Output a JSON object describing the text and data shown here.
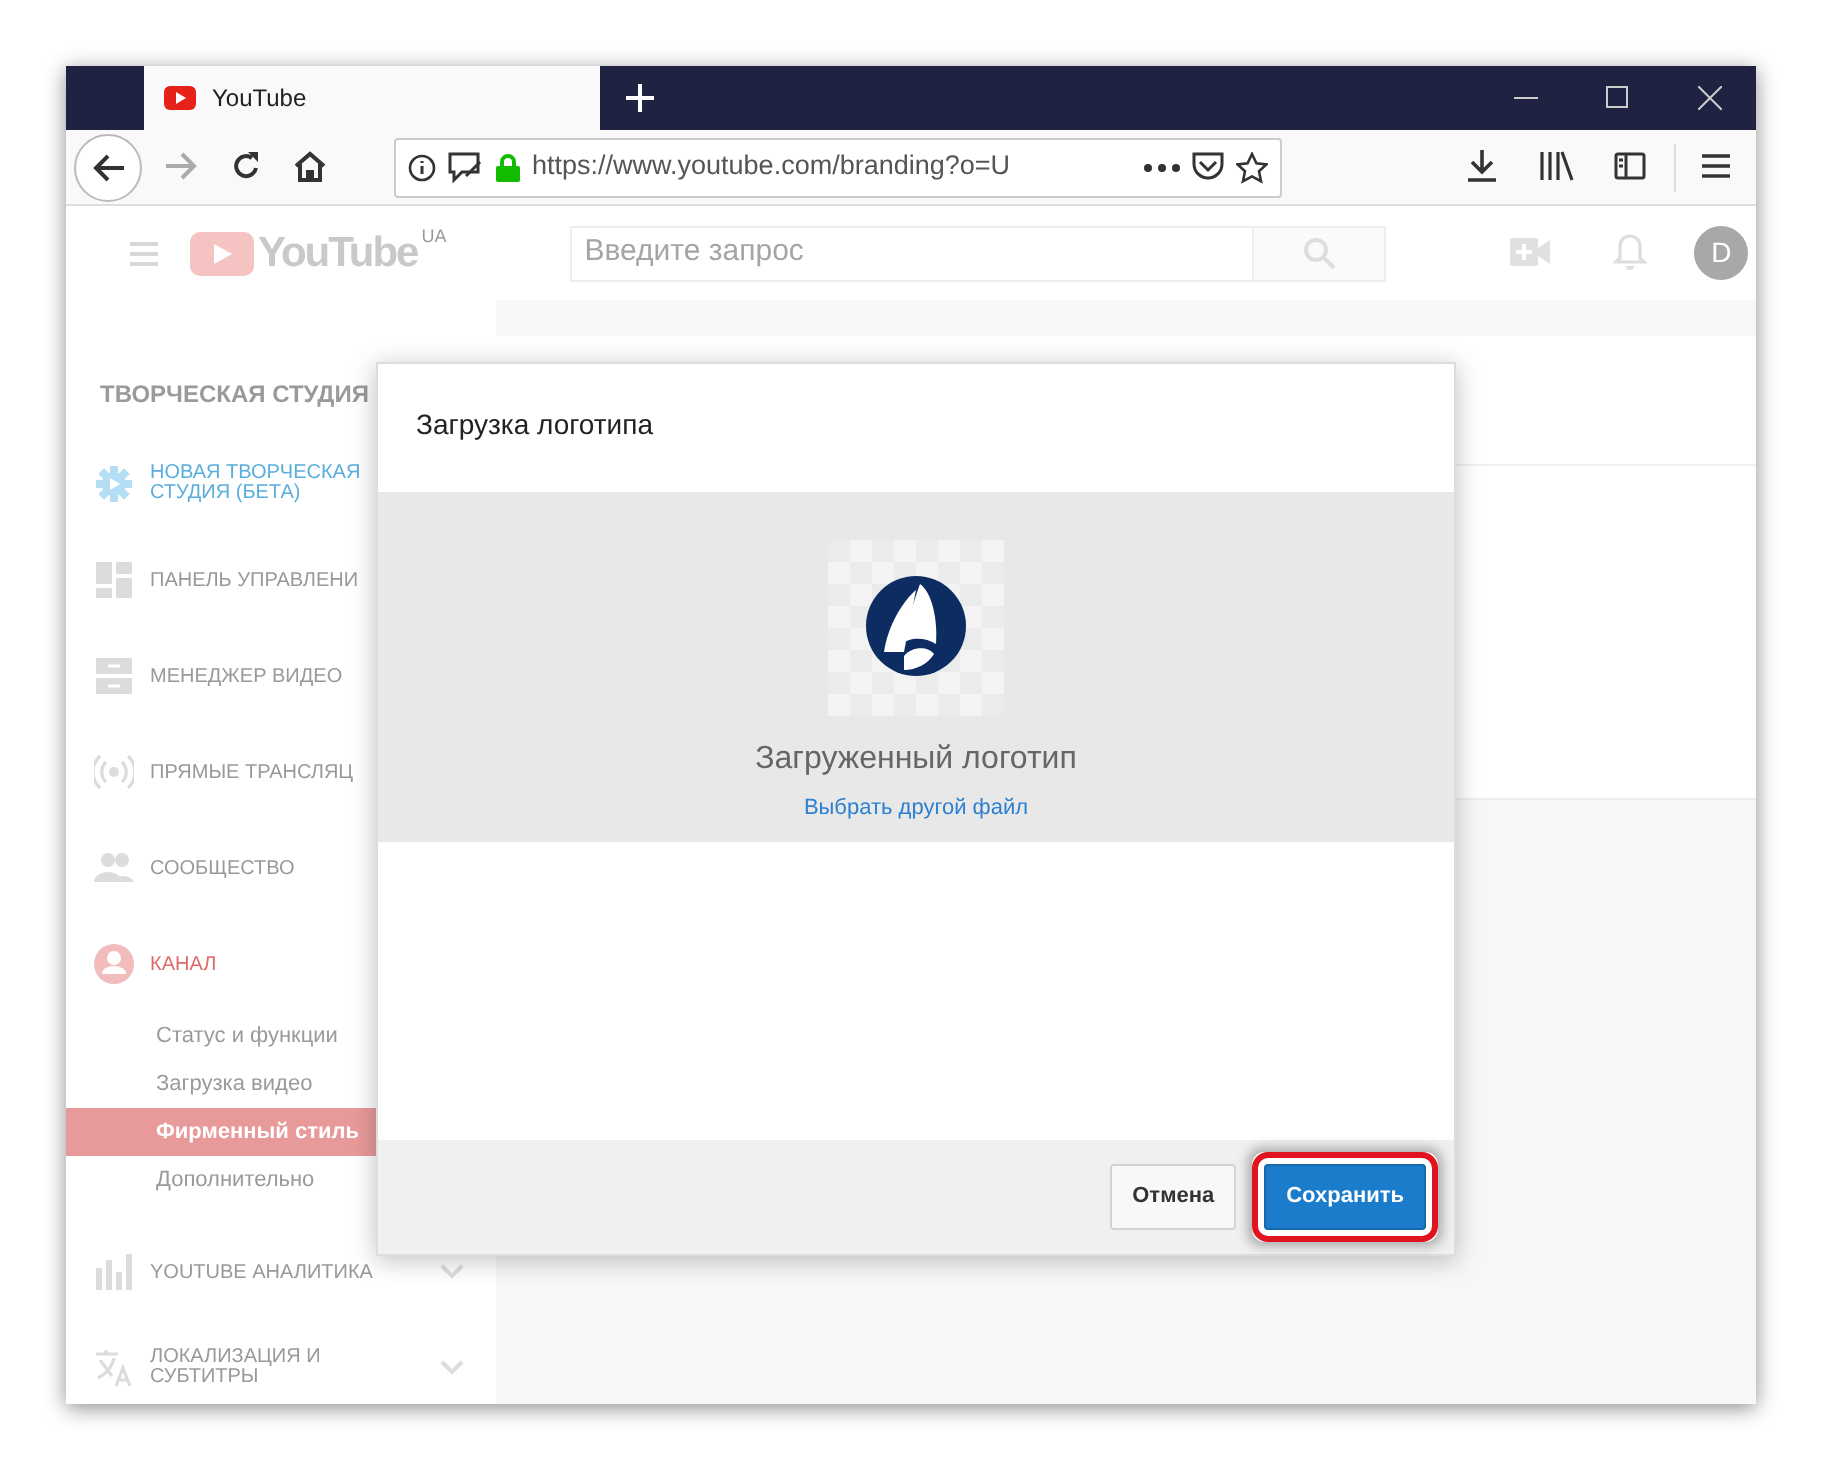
{
  "browser": {
    "tabs": [
      {
        "title": "YouTube",
        "selected": true
      }
    ],
    "url": "https://www.youtube.com/branding?o=U"
  },
  "header": {
    "logo_text": "YouTube",
    "region": "UA",
    "search": {
      "placeholder": "Введите запрос"
    },
    "avatar": "D"
  },
  "sidebar": {
    "heading": "ТВОРЧЕСКАЯ СТУДИЯ",
    "items": [
      {
        "label": "НОВАЯ ТВОРЧЕСКАЯ СТУДИЯ (БЕТА)",
        "kind": "beta",
        "selected": false
      },
      {
        "label": "ПАНЕЛЬ УПРАВЛЕНИ",
        "kind": "section",
        "selected": false
      },
      {
        "label": "МЕНЕДЖЕР ВИДЕО",
        "kind": "section",
        "selected": false
      },
      {
        "label": "ПРЯМЫЕ ТРАНСЛЯЦ",
        "kind": "section",
        "selected": false
      },
      {
        "label": "СООБЩЕСТВО",
        "kind": "section",
        "selected": false
      },
      {
        "label": "КАНАЛ",
        "kind": "section",
        "selected": true,
        "children": [
          {
            "label": "Статус и функции",
            "selected": false
          },
          {
            "label": "Загрузка видео",
            "selected": false
          },
          {
            "label": "Фирменный стиль",
            "selected": true
          },
          {
            "label": "Дополнительно",
            "selected": false
          }
        ]
      },
      {
        "label": "YOUTUBE АНАЛИТИКА",
        "kind": "section",
        "selected": false,
        "expanded": false
      },
      {
        "label": "ЛОКАЛИЗАЦИЯ И СУБТИТРЫ",
        "kind": "section",
        "selected": false,
        "expanded": false
      }
    ]
  },
  "dialog": {
    "title": "Загрузка логотипа",
    "caption": "Загруженный логотип",
    "link": "Выбрать другой файл",
    "buttons": [
      {
        "label": "Отмена",
        "kind": "secondary",
        "annotated": false
      },
      {
        "label": "Сохранить",
        "kind": "primary",
        "annotated": true
      }
    ]
  }
}
